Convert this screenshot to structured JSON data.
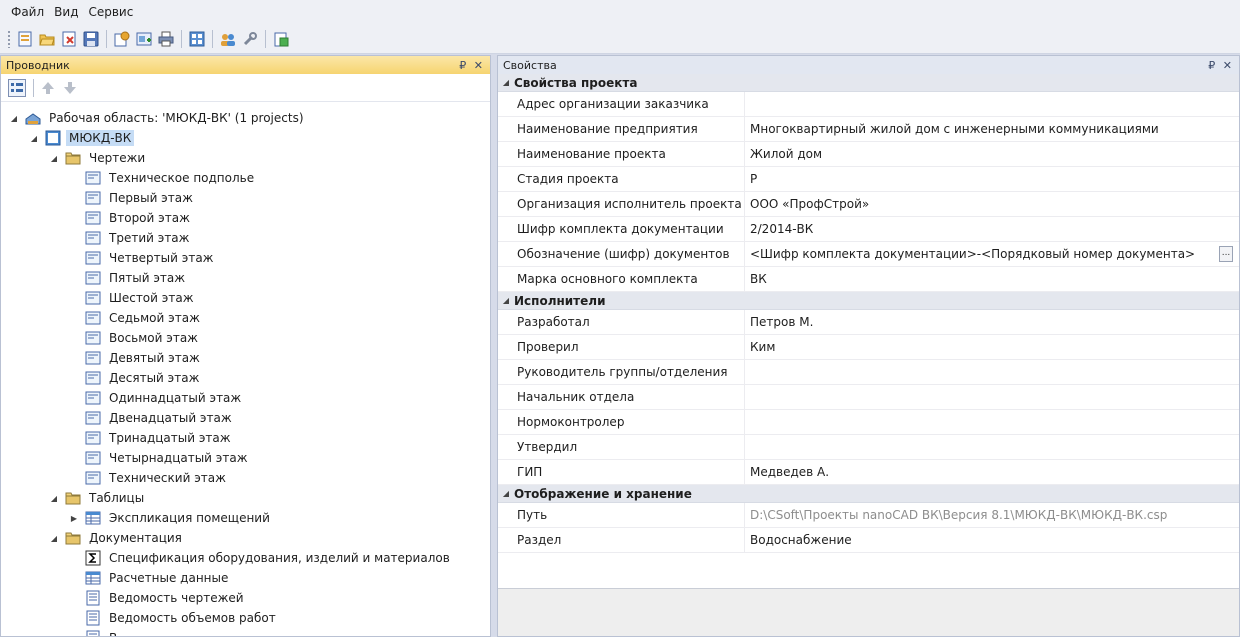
{
  "menu": [
    "Файл",
    "Вид",
    "Сервис"
  ],
  "toolbar_icons": [
    "new-icon",
    "open-icon",
    "close-project-icon",
    "save-icon",
    "project-settings-icon",
    "add-drawing-icon",
    "print-icon",
    "layout-icon",
    "users-icon",
    "tools-icon",
    "export-icon"
  ],
  "explorer": {
    "title": "Проводник",
    "controls": "₽ ✕",
    "tree": [
      {
        "level": 0,
        "arrow": "expanded",
        "icon": "workspace-icon",
        "label": "Рабочая область: 'МЮКД-ВК' (1 projects)"
      },
      {
        "level": 1,
        "arrow": "expanded",
        "icon": "project-icon",
        "label": "МЮКД-ВК",
        "selected": true
      },
      {
        "level": 2,
        "arrow": "expanded",
        "icon": "folder-icon",
        "label": "Чертежи"
      },
      {
        "level": 3,
        "arrow": "none",
        "icon": "drawing-icon",
        "label": "Техническое подполье"
      },
      {
        "level": 3,
        "arrow": "none",
        "icon": "drawing-icon",
        "label": "Первый этаж"
      },
      {
        "level": 3,
        "arrow": "none",
        "icon": "drawing-icon",
        "label": "Второй этаж"
      },
      {
        "level": 3,
        "arrow": "none",
        "icon": "drawing-icon",
        "label": "Третий этаж"
      },
      {
        "level": 3,
        "arrow": "none",
        "icon": "drawing-icon",
        "label": "Четвертый этаж"
      },
      {
        "level": 3,
        "arrow": "none",
        "icon": "drawing-icon",
        "label": "Пятый этаж"
      },
      {
        "level": 3,
        "arrow": "none",
        "icon": "drawing-icon",
        "label": "Шестой этаж"
      },
      {
        "level": 3,
        "arrow": "none",
        "icon": "drawing-icon",
        "label": "Седьмой этаж"
      },
      {
        "level": 3,
        "arrow": "none",
        "icon": "drawing-icon",
        "label": "Восьмой этаж"
      },
      {
        "level": 3,
        "arrow": "none",
        "icon": "drawing-icon",
        "label": "Девятый этаж"
      },
      {
        "level": 3,
        "arrow": "none",
        "icon": "drawing-icon",
        "label": "Десятый этаж"
      },
      {
        "level": 3,
        "arrow": "none",
        "icon": "drawing-icon",
        "label": "Одиннадцатый этаж"
      },
      {
        "level": 3,
        "arrow": "none",
        "icon": "drawing-icon",
        "label": "Двенадцатый этаж"
      },
      {
        "level": 3,
        "arrow": "none",
        "icon": "drawing-icon",
        "label": "Тринадцатый этаж"
      },
      {
        "level": 3,
        "arrow": "none",
        "icon": "drawing-icon",
        "label": "Четырнадцатый этаж"
      },
      {
        "level": 3,
        "arrow": "none",
        "icon": "drawing-icon",
        "label": "Технический этаж"
      },
      {
        "level": 2,
        "arrow": "expanded",
        "icon": "folder-icon",
        "label": "Таблицы"
      },
      {
        "level": 3,
        "arrow": "collapsed",
        "icon": "table-icon",
        "label": "Экспликация помещений"
      },
      {
        "level": 2,
        "arrow": "expanded",
        "icon": "folder-icon",
        "label": "Документация"
      },
      {
        "level": 3,
        "arrow": "none",
        "icon": "sum-icon",
        "label": "Спецификация оборудования, изделий и материалов"
      },
      {
        "level": 3,
        "arrow": "none",
        "icon": "table-icon",
        "label": "Расчетные данные"
      },
      {
        "level": 3,
        "arrow": "none",
        "icon": "document-icon",
        "label": "Ведомость чертежей"
      },
      {
        "level": 3,
        "arrow": "none",
        "icon": "document-icon",
        "label": "Ведомость объемов работ"
      },
      {
        "level": 3,
        "arrow": "none",
        "icon": "document-icon",
        "label": "В"
      }
    ]
  },
  "properties": {
    "title": "Свойства",
    "controls": "₽ ✕",
    "categories": [
      {
        "name": "Свойства проекта",
        "rows": [
          {
            "name": "Адрес организации заказчика",
            "value": ""
          },
          {
            "name": "Наименование предприятия",
            "value": "Многоквартирный жилой дом с инженерными коммуникациями"
          },
          {
            "name": "Наименование проекта",
            "value": "Жилой дом"
          },
          {
            "name": "Стадия проекта",
            "value": "Р"
          },
          {
            "name": "Организация исполнитель проекта",
            "value": "ООО «ПрофСтрой»"
          },
          {
            "name": "Шифр комплекта документации",
            "value": "2/2014-ВК"
          },
          {
            "name": "Обозначение (шифр) документов",
            "value": "<Шифр комплекта документации>-<Порядковый номер документа>",
            "button": "..."
          },
          {
            "name": "Марка основного комплекта",
            "value": "ВК"
          }
        ]
      },
      {
        "name": "Исполнители",
        "rows": [
          {
            "name": "Разработал",
            "value": "Петров М."
          },
          {
            "name": "Проверил",
            "value": "Ким"
          },
          {
            "name": "Руководитель группы/отделения",
            "value": ""
          },
          {
            "name": "Начальник отдела",
            "value": ""
          },
          {
            "name": "Нормоконтролер",
            "value": ""
          },
          {
            "name": "Утвердил",
            "value": ""
          },
          {
            "name": "ГИП",
            "value": "Медведев А."
          }
        ]
      },
      {
        "name": "Отображение и хранение",
        "rows": [
          {
            "name": "Путь",
            "value": "D:\\CSoft\\Проекты nanoCAD ВК\\Версия 8.1\\МЮКД-ВК\\МЮКД-ВК.csp",
            "muted": true
          },
          {
            "name": "Раздел",
            "value": "Водоснабжение"
          }
        ]
      }
    ]
  }
}
